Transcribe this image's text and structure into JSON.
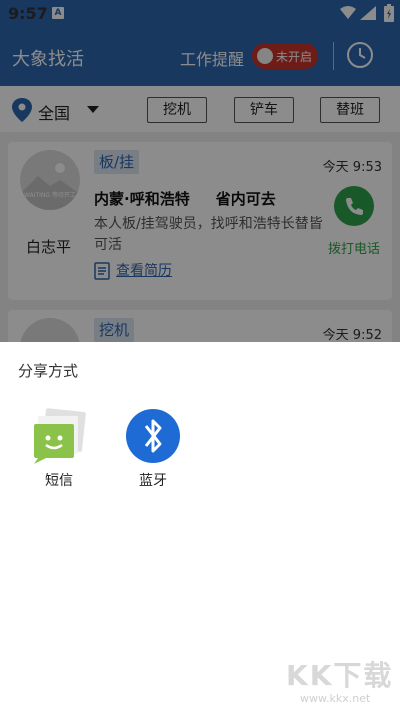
{
  "status_bar": {
    "time": "9:57",
    "notif_letter": "A"
  },
  "app_bar": {
    "title": "大象找活",
    "remind_label": "工作提醒",
    "toggle_label": "未开启"
  },
  "filter": {
    "region": "全国",
    "chips": [
      "挖机",
      "铲车",
      "替班"
    ]
  },
  "cards": [
    {
      "avatar_caption": "WAITING 等待开工",
      "name": "白志平",
      "tag": "板/挂",
      "time": "今天 9:53",
      "route_from": "内蒙·呼和浩特",
      "route_to": "省内可去",
      "desc": "本人板/挂驾驶员，找呼和浩特长替皆可活",
      "resume": "查看简历",
      "call_label": "拨打电话"
    },
    {
      "tag": "挖机",
      "time": "今天 9:52"
    }
  ],
  "share_sheet": {
    "title": "分享方式",
    "items": [
      {
        "label": "短信",
        "icon": "sms-icon"
      },
      {
        "label": "蓝牙",
        "icon": "bluetooth-icon"
      }
    ]
  },
  "watermark": {
    "brand": "KK下载",
    "url": "www.kkx.net"
  },
  "colors": {
    "primary": "#2f66ad",
    "toggle_red": "#c8332d",
    "call_green": "#2fa04a",
    "sms_green": "#8bc34a",
    "bluetooth_blue": "#1e6bd6"
  }
}
